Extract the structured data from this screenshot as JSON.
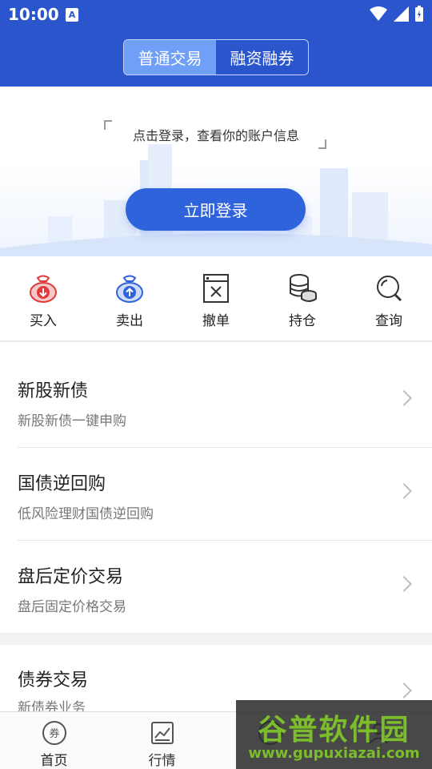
{
  "status_bar": {
    "time": "10:00",
    "app_icon": "A"
  },
  "header": {
    "tabs": [
      {
        "label": "普通交易",
        "active": true
      },
      {
        "label": "融资融券",
        "active": false
      }
    ]
  },
  "banner": {
    "tip": "点击登录，查看你的账户信息",
    "login_button": "立即登录"
  },
  "quick_actions": [
    {
      "label": "买入",
      "icon": "buy-bag-icon",
      "color": "#e03a3a"
    },
    {
      "label": "卖出",
      "icon": "sell-bag-icon",
      "color": "#2e63dc"
    },
    {
      "label": "撤单",
      "icon": "cancel-order-icon",
      "color": "#333333"
    },
    {
      "label": "持仓",
      "icon": "coins-stack-icon",
      "color": "#333333"
    },
    {
      "label": "查询",
      "icon": "search-icon",
      "color": "#333333"
    }
  ],
  "menu": [
    {
      "title": "新股新债",
      "subtitle": "新股新债一键申购"
    },
    {
      "title": "国债逆回购",
      "subtitle": "低风险理财国债逆回购"
    },
    {
      "title": "盘后定价交易",
      "subtitle": "盘后固定价格交易"
    }
  ],
  "menu2": [
    {
      "title": "债券交易",
      "subtitle": "新债券业务"
    }
  ],
  "bottom_nav": [
    {
      "label": "首页",
      "icon": "coupon-circle-icon",
      "active": true
    },
    {
      "label": "行情",
      "icon": "chart-icon",
      "active": false
    },
    {
      "label": "",
      "icon": "trade-icon",
      "active": false
    },
    {
      "label": "",
      "icon": "profile-icon",
      "active": false
    }
  ],
  "watermark": {
    "title": "谷普软件园",
    "url": "www.gupuxiazai.com"
  },
  "colors": {
    "primary": "#2b55cc",
    "button": "#2e63dc",
    "buy": "#e03a3a"
  }
}
